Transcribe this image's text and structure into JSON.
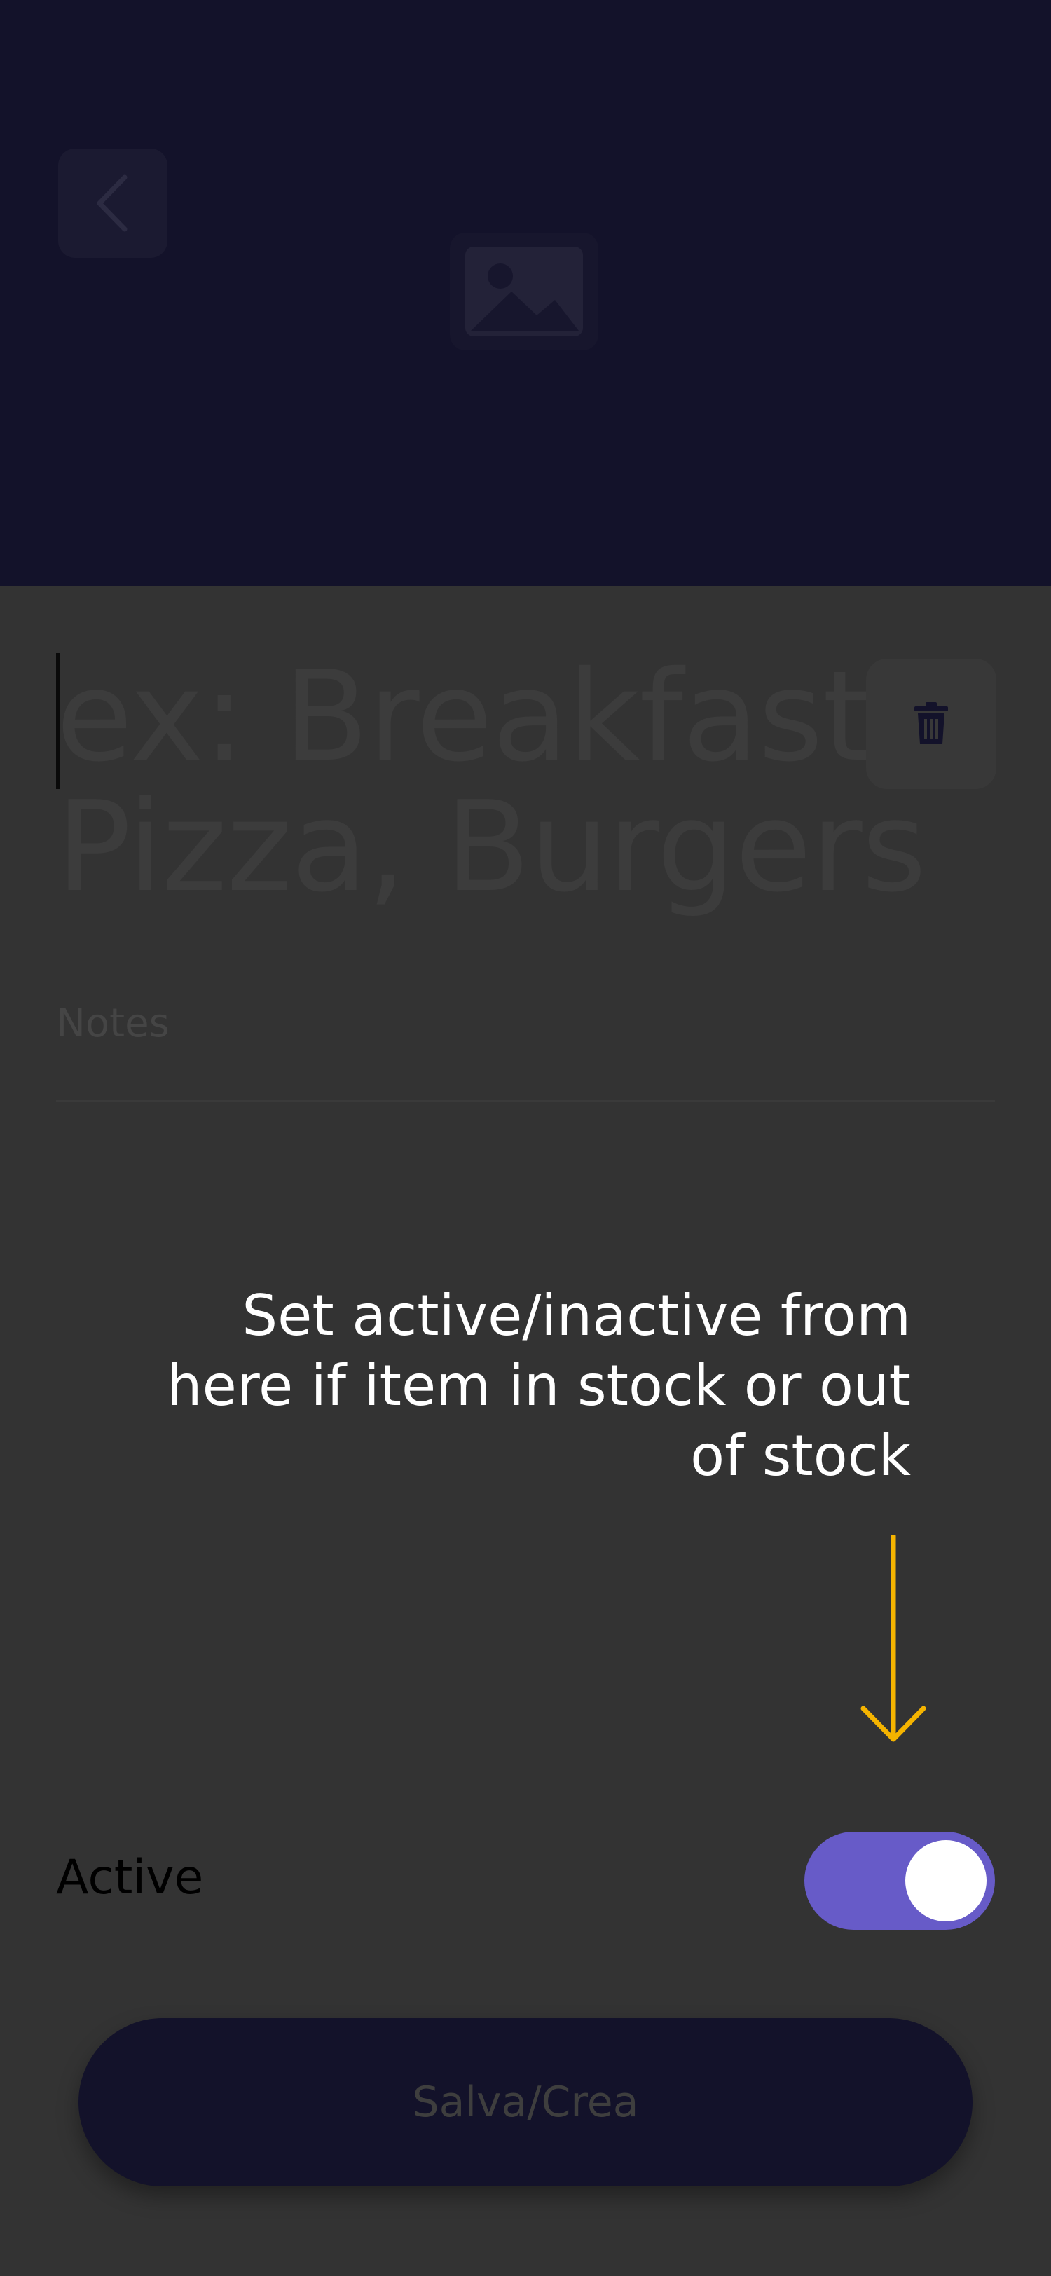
{
  "header": {
    "back_icon": "chevron-left-icon",
    "image_icon": "image-placeholder-icon"
  },
  "form": {
    "name_placeholder": "ex: Breakfast, Pizza, Burgers",
    "notes_placeholder": "Notes",
    "delete_icon": "trash-icon"
  },
  "tooltip": {
    "text": "Set active/inactive from here if item in stock or out of stock",
    "accent_color": "#f5b400"
  },
  "active": {
    "label": "Active",
    "enabled": true,
    "toggle_color": "#675bc8"
  },
  "actions": {
    "save_label": "Salva/Crea"
  }
}
